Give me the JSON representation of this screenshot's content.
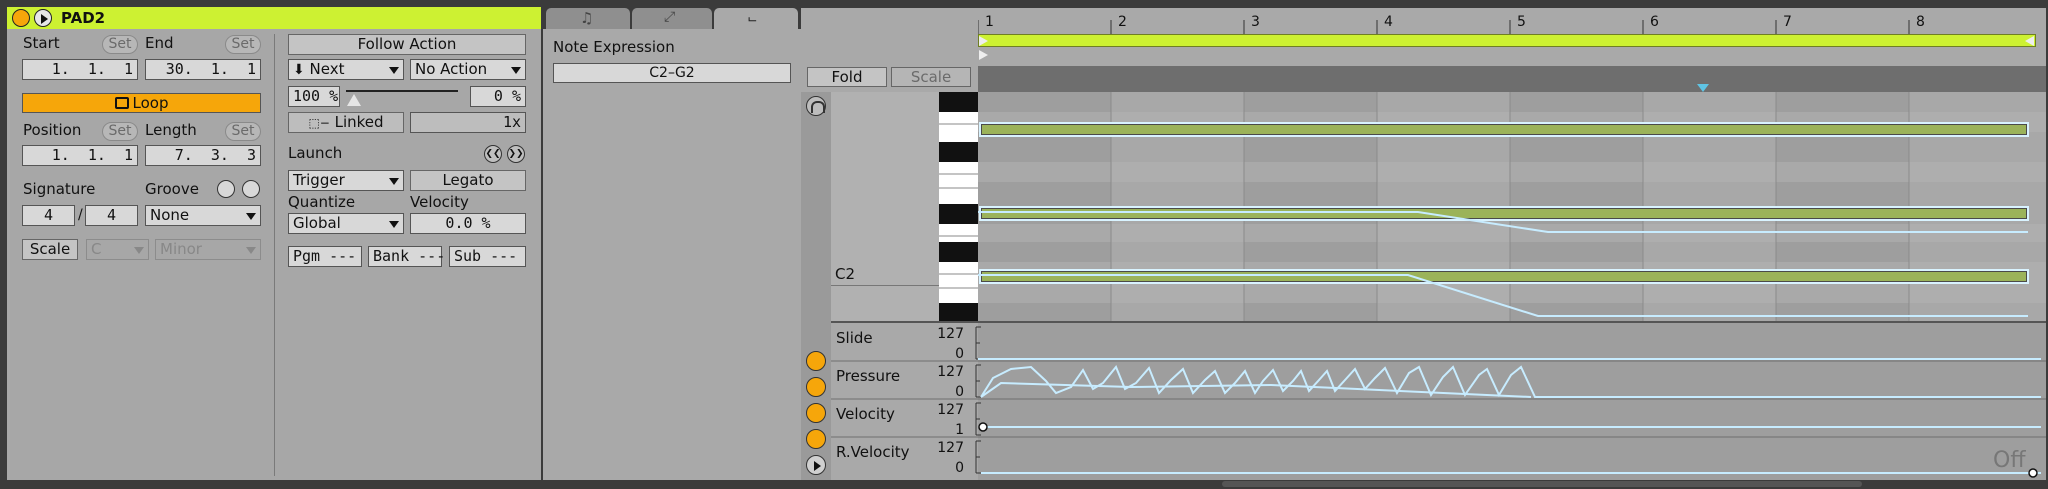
{
  "clip": {
    "title": "PAD2",
    "start_label": "Start",
    "end_label": "End",
    "set_label": "Set",
    "start_value": "1.  1.  1",
    "end_value": "30.  1.  1",
    "loop_label": "Loop",
    "position_label": "Position",
    "length_label": "Length",
    "position_value": "1.  1.  1",
    "length_value": "7.  3.  3",
    "signature_label": "Signature",
    "groove_label": "Groove",
    "sig_num": "4",
    "sig_den": "4",
    "groove_value": "None",
    "scale_label": "Scale",
    "scale_root": "C",
    "scale_mode": "Minor",
    "accent_color": "#cdf132"
  },
  "launch": {
    "follow_action_label": "Follow Action",
    "next_label": "Next",
    "no_action_label": "No Action",
    "chance_left": "100 %",
    "chance_right": "0 %",
    "linked_label": "Linked",
    "linked_value": "1x",
    "launch_label": "Launch",
    "trigger_value": "Trigger",
    "legato_label": "Legato",
    "quantize_label": "Quantize",
    "velocity_label": "Velocity",
    "quantize_value": "Global",
    "velocity_value": "0.0 %",
    "pgm_label": "Pgm ---",
    "bank_label": "Bank ---",
    "sub_label": "Sub ---"
  },
  "expression": {
    "title": "Note Expression",
    "range": "C2–G2"
  },
  "editor": {
    "fold_label": "Fold",
    "scale_label": "Scale",
    "ruler": [
      "1",
      "2",
      "3",
      "4",
      "5",
      "6",
      "7",
      "8"
    ],
    "key_label": "C2",
    "lanes": [
      {
        "name": "Slide",
        "max": "127",
        "min": "0"
      },
      {
        "name": "Pressure",
        "max": "127",
        "min": "0"
      },
      {
        "name": "Velocity",
        "max": "127",
        "min": "1"
      },
      {
        "name": "R.Velocity",
        "max": "127",
        "min": "0"
      }
    ],
    "off_label": "Off",
    "note_color": "#9bb35a",
    "curve_color": "#c7ecff"
  }
}
